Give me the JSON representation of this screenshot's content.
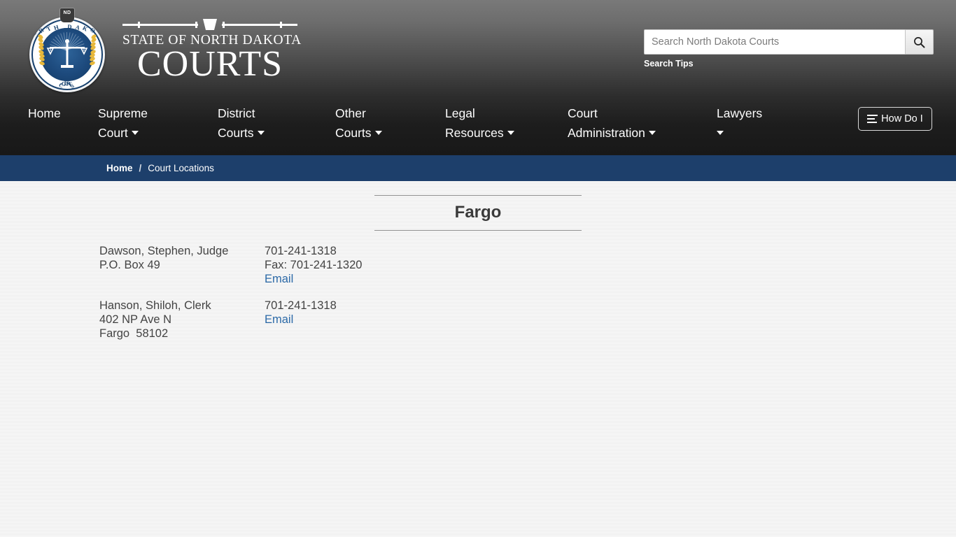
{
  "header": {
    "logo": {
      "seal_top_text": "NORTH DAKOTA",
      "seal_bottom_text": "COURTS",
      "seal_tab_text": "ND",
      "wordmark_line1": "STATE OF NORTH DAKOTA",
      "wordmark_line2": "COURTS"
    },
    "search": {
      "placeholder": "Search North Dakota Courts",
      "value": "",
      "button_icon": "search-icon",
      "tips_label": "Search Tips"
    }
  },
  "nav": {
    "items": [
      {
        "line1": "Home",
        "line2": "",
        "has_caret": false
      },
      {
        "line1": "Supreme",
        "line2": "Court",
        "has_caret": true
      },
      {
        "line1": "District",
        "line2": "Courts",
        "has_caret": true
      },
      {
        "line1": "Other",
        "line2": "Courts",
        "has_caret": true
      },
      {
        "line1": "Legal",
        "line2": "Resources",
        "has_caret": true
      },
      {
        "line1": "Court",
        "line2": "Administration",
        "has_caret": true
      },
      {
        "line1": "Lawyers",
        "line2": "",
        "has_caret": true
      }
    ],
    "how_do_i": {
      "label": "How Do I",
      "icon": "list-lines-icon"
    }
  },
  "breadcrumb": {
    "home_label": "Home",
    "separator": "/",
    "current_label": "Court Locations"
  },
  "main": {
    "page_title": "Fargo",
    "entries": [
      {
        "name": "Dawson, Stephen, Judge",
        "address": [
          "P.O. Box 49"
        ],
        "phone": "701-241-1318",
        "fax": "Fax: 701-241-1320",
        "email_label": "Email"
      },
      {
        "name": "Hanson, Shiloh, Clerk",
        "address": [
          "402 NP Ave N",
          "Fargo  58102"
        ],
        "phone": "701-241-1318",
        "fax": "",
        "email_label": "Email"
      }
    ]
  },
  "colors": {
    "breadcrumb_bar": "#1d3f6b",
    "link_blue": "#2c6aa8",
    "seal_navy": "#16406e",
    "wheat_gold": "#e8b83a",
    "body_text": "#444444",
    "page_bg": "#f0f0f0"
  }
}
